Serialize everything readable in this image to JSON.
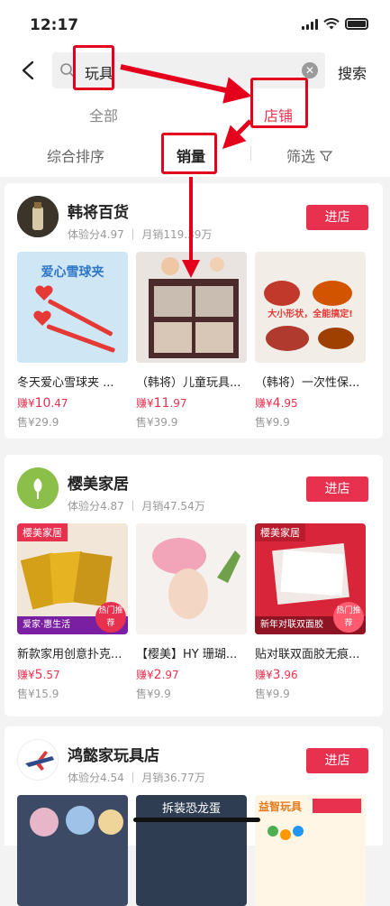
{
  "status": {
    "time": "12:17"
  },
  "search": {
    "query": "玩具",
    "button": "搜索"
  },
  "type_tabs": [
    {
      "label": "全部"
    },
    {
      "label": "店铺"
    }
  ],
  "sort_tabs": [
    {
      "label": "综合排序"
    },
    {
      "label": "销量"
    },
    {
      "label": "筛选"
    }
  ],
  "stores": [
    {
      "name": "韩将百货",
      "meta": "体验分4.97 ｜ 月销119.39万",
      "enter": "进店",
      "products": [
        {
          "title": "冬天爱心雪球夹 ...",
          "earn_prefix": "赚¥",
          "earn_int": "10",
          "earn_dec": ".47",
          "sale": "售¥29.9",
          "img_text": "爱心雪球夹"
        },
        {
          "title": "（韩将）儿童玩具...",
          "earn_prefix": "赚¥",
          "earn_int": "11",
          "earn_dec": ".97",
          "sale": "售¥39.9",
          "img_text": ""
        },
        {
          "title": "（韩将）一次性保...",
          "earn_prefix": "赚¥",
          "earn_int": "4",
          "earn_dec": ".95",
          "sale": "售¥9.9",
          "img_text": "大小形状，全能搞定!"
        }
      ]
    },
    {
      "name": "樱美家居",
      "meta": "体验分4.87 ｜ 月销47.54万",
      "enter": "进店",
      "products": [
        {
          "title": "新款家用创意扑克...",
          "earn_prefix": "赚¥",
          "earn_int": "5",
          "earn_dec": ".57",
          "sale": "售¥15.9",
          "img_text": "樱美家居",
          "img_footer": "爱家·惠生活",
          "img_badge": "热门推荐"
        },
        {
          "title": "【樱美】HY 珊瑚...",
          "earn_prefix": "赚¥",
          "earn_int": "2",
          "earn_dec": ".97",
          "sale": "售¥9.9",
          "img_text": ""
        },
        {
          "title": "贴对联双面胶无痕...",
          "earn_prefix": "赚¥",
          "earn_int": "3",
          "earn_dec": ".96",
          "sale": "售¥9.9",
          "img_text": "樱美家居",
          "img_footer": "新年对联双面胶",
          "img_badge": "热门推荐"
        }
      ]
    },
    {
      "name": "鸿懿家玩具店",
      "meta": "体验分4.54 ｜ 月销36.77万",
      "enter": "进店",
      "products": [
        {
          "img_text": ""
        },
        {
          "img_text": "拆装恐龙蛋"
        },
        {
          "img_text": "益智玩具"
        }
      ]
    }
  ]
}
